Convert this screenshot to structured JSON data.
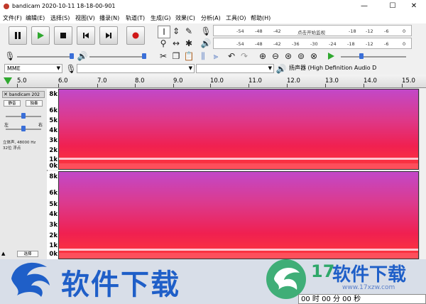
{
  "window": {
    "title": "bandicam 2020-10-11 18-18-00-901",
    "minimize": "—",
    "maximize": "☐",
    "close": "✕"
  },
  "menu": [
    "文件(F)",
    "编辑(E)",
    "选择(S)",
    "视图(V)",
    "播录(N)",
    "轨道(T)",
    "生成(G)",
    "效果(C)",
    "分析(A)",
    "工具(O)",
    "帮助(H)"
  ],
  "transport": {
    "pause": "pause-icon",
    "play": "play-icon",
    "stop": "stop-icon",
    "skip_start": "skip-start-icon",
    "skip_end": "skip-end-icon",
    "record": "record-icon"
  },
  "meter": {
    "record_ticks": [
      "-54",
      "-48",
      "-42",
      "-18",
      "-12",
      "-6",
      "0"
    ],
    "click_to_monitor": "点击开始监视",
    "playback_ticks": [
      "-54",
      "-48",
      "-42",
      "-36",
      "-30",
      "-24",
      "-18",
      "-12",
      "-6",
      "0"
    ]
  },
  "devices": {
    "host": "MME",
    "output": "扬声器 (High Definition Audio D"
  },
  "timeline": {
    "ticks": [
      "5.0",
      "6.0",
      "7.0",
      "8.0",
      "9.0",
      "10.0",
      "11.0",
      "12.0",
      "13.0",
      "14.0",
      "15.0"
    ]
  },
  "track": {
    "name": "bandicam 202",
    "mute": "静音",
    "solo": "独奏",
    "left": "左",
    "right": "右",
    "info_line1": "立体声, 48000 Hz",
    "info_line2": "32位 浮点",
    "select": "选择"
  },
  "freq_labels": [
    "8k",
    "6k",
    "5k",
    "4k",
    "3k",
    "2k",
    "1k",
    "0k"
  ],
  "watermark": {
    "left_text": "软件下载",
    "right_num": "17",
    "right_text": "软件下载",
    "right_url": "www.17xzw.com"
  },
  "time_display": "00 时 00 分 00 秒",
  "colors": {
    "spectrogram_base": "#e8285c",
    "spectrogram_top": "#c248c8",
    "accent_blue": "#1f5fc8",
    "play_green": "#2fa82f",
    "record_red": "#d01818"
  }
}
